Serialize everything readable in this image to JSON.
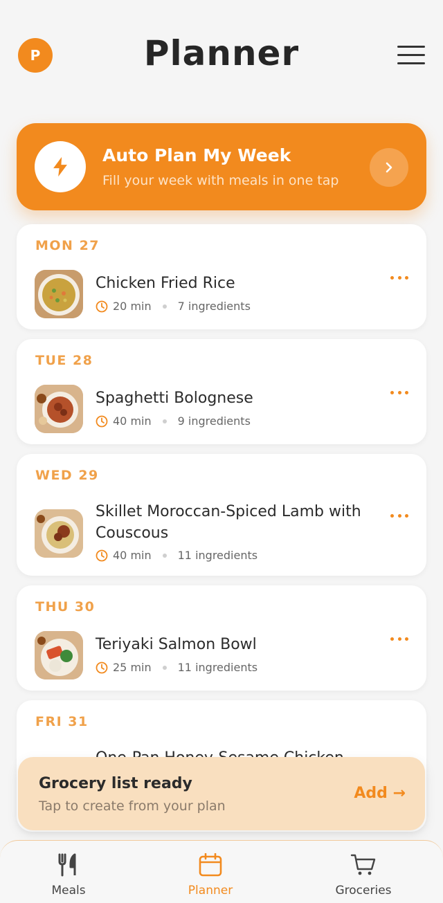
{
  "header": {
    "avatar_initial": "P",
    "title": "Planner"
  },
  "banner": {
    "title": "Auto Plan My Week",
    "subtitle": "Fill your week with meals in one tap"
  },
  "days": [
    {
      "label": "MON 27",
      "meal": "Chicken Fried Rice",
      "time": "20 min",
      "ingredients": "7 ingredients"
    },
    {
      "label": "TUE 28",
      "meal": "Spaghetti Bolognese",
      "time": "40 min",
      "ingredients": "9 ingredients"
    },
    {
      "label": "WED 29",
      "meal": "Skillet Moroccan-Spiced Lamb with Couscous",
      "time": "40 min",
      "ingredients": "11 ingredients"
    },
    {
      "label": "THU 30",
      "meal": "Teriyaki Salmon Bowl",
      "time": "25 min",
      "ingredients": "11 ingredients"
    },
    {
      "label": "FRI 31",
      "meal": "One-Pan Honey-Sesame Chicken"
    }
  ],
  "toast": {
    "title": "Grocery list ready",
    "subtitle": "Tap to create from your plan",
    "action": "Add →"
  },
  "nav": {
    "meals": "Meals",
    "planner": "Planner",
    "groceries": "Groceries",
    "active": "planner"
  },
  "colors": {
    "accent": "#f28a1e",
    "day_label": "#f0a14a",
    "toast_bg": "#f9dfbf",
    "background": "#f5f5f5"
  },
  "icons": {
    "banner": "lightning-bolt-icon",
    "banner_action": "chevron-right-icon",
    "meta": "clock-icon",
    "card_action": "more-dots-icon",
    "nav_meals": "fork-knife-icon",
    "nav_planner": "calendar-icon",
    "nav_groceries": "cart-icon"
  }
}
